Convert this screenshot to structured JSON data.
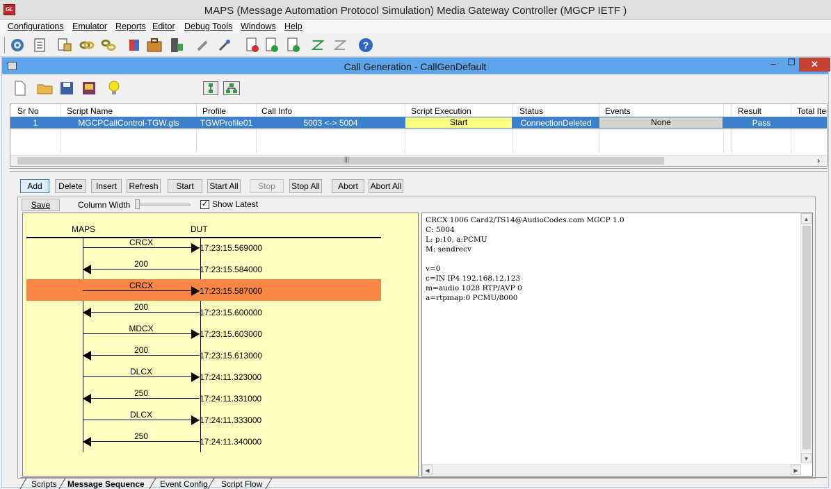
{
  "app": {
    "title": "MAPS (Message Automation Protocol Simulation) Media Gateway Controller (MGCP IETF )",
    "logo_text": "GL"
  },
  "menu": [
    "Configurations",
    "Emulator",
    "Reports",
    "Editor",
    "Debug Tools",
    "Windows",
    "Help"
  ],
  "toolbar_icons": [
    "configuration-gear-icon",
    "script-list-icon",
    "profile-editor-icon",
    "link-icon",
    "chain-icon",
    "database-icon",
    "briefcase-icon",
    "server-icon",
    "tools-icon",
    "wizard-icon",
    "doc-d-icon",
    "doc-c-icon",
    "doc-p-icon",
    "sync-icon",
    "trace-icon",
    "help-icon"
  ],
  "window": {
    "title": "Call Generation  - CallGenDefault",
    "minimize": "–",
    "maximize": "☐",
    "close": "✕"
  },
  "doc_toolbar_icons": [
    "new-file-icon",
    "open-folder-icon",
    "save-icon",
    "save-as-icon",
    "bulb-icon",
    "vertical-layout-icon",
    "tree-layout-icon"
  ],
  "grid": {
    "headers": [
      "Sr No",
      "Script Name",
      "Profile",
      "Call Info",
      "Script Execution",
      "Status",
      "Events",
      "Result",
      "Total Iter"
    ],
    "rows": [
      {
        "sr_no": "1",
        "script_name": "MGCPCallControl-TGW.gls",
        "profile": "TGWProfile01",
        "call_info": "5003 <-> 5004",
        "script_execution": "Start",
        "status": "ConnectionDeleted",
        "events": "None",
        "result": "Pass",
        "total_iter": ""
      }
    ],
    "scroll_grip": "|||"
  },
  "buttons": {
    "add": "Add",
    "delete": "Delete",
    "insert": "Insert",
    "refresh": "Refresh",
    "start": "Start",
    "start_all": "Start All",
    "stop": "Stop",
    "stop_all": "Stop All",
    "abort": "Abort",
    "abort_all": "Abort All"
  },
  "sequence": {
    "save": "Save",
    "column_width": "Column Width",
    "show_latest": "Show Latest",
    "show_latest_checked": true,
    "left_entity": "MAPS",
    "right_entity": "DUT",
    "messages": [
      {
        "label": "CRCX",
        "dir": "right",
        "time": "17:23:15.569000",
        "highlighted": false
      },
      {
        "label": "200",
        "dir": "left",
        "time": "17:23:15.584000",
        "highlighted": false
      },
      {
        "label": "CRCX",
        "dir": "right",
        "time": "17:23:15.587000",
        "highlighted": true
      },
      {
        "label": "200",
        "dir": "left",
        "time": "17:23:15.600000",
        "highlighted": false
      },
      {
        "label": "MDCX",
        "dir": "right",
        "time": "17:23:15.603000",
        "highlighted": false
      },
      {
        "label": "200",
        "dir": "left",
        "time": "17:23:15.613000",
        "highlighted": false
      },
      {
        "label": "DLCX",
        "dir": "right",
        "time": "17:24:11.323000",
        "highlighted": false
      },
      {
        "label": "250",
        "dir": "left",
        "time": "17:24:11.331000",
        "highlighted": false
      },
      {
        "label": "DLCX",
        "dir": "right",
        "time": "17:24:11.333000",
        "highlighted": false
      },
      {
        "label": "250",
        "dir": "left",
        "time": "17:24:11.340000",
        "highlighted": false
      }
    ],
    "highlight_color": "#f98744",
    "ladder_bg": "#fffdc0"
  },
  "detail": {
    "text": "CRCX 1006 Card2/TS14@AudioCodes.com MGCP 1.0\nC: 5004\nL: p:10, a:PCMU\nM: sendrecv\n\nv=0\nc=IN IP4 192.168.12.123\nm=audio 1028 RTP/AVP 0\na=rtpmap:0 PCMU/8000"
  },
  "tabs": [
    "Scripts",
    "Message Sequence",
    "Event Config",
    "Script Flow"
  ],
  "active_tab": "Message Sequence",
  "colors": {
    "window_title_bar": "#5da4e8",
    "selected_row": "#3b80c8",
    "script_execution_cell": "#ffff80",
    "close_button": "#c84031"
  }
}
